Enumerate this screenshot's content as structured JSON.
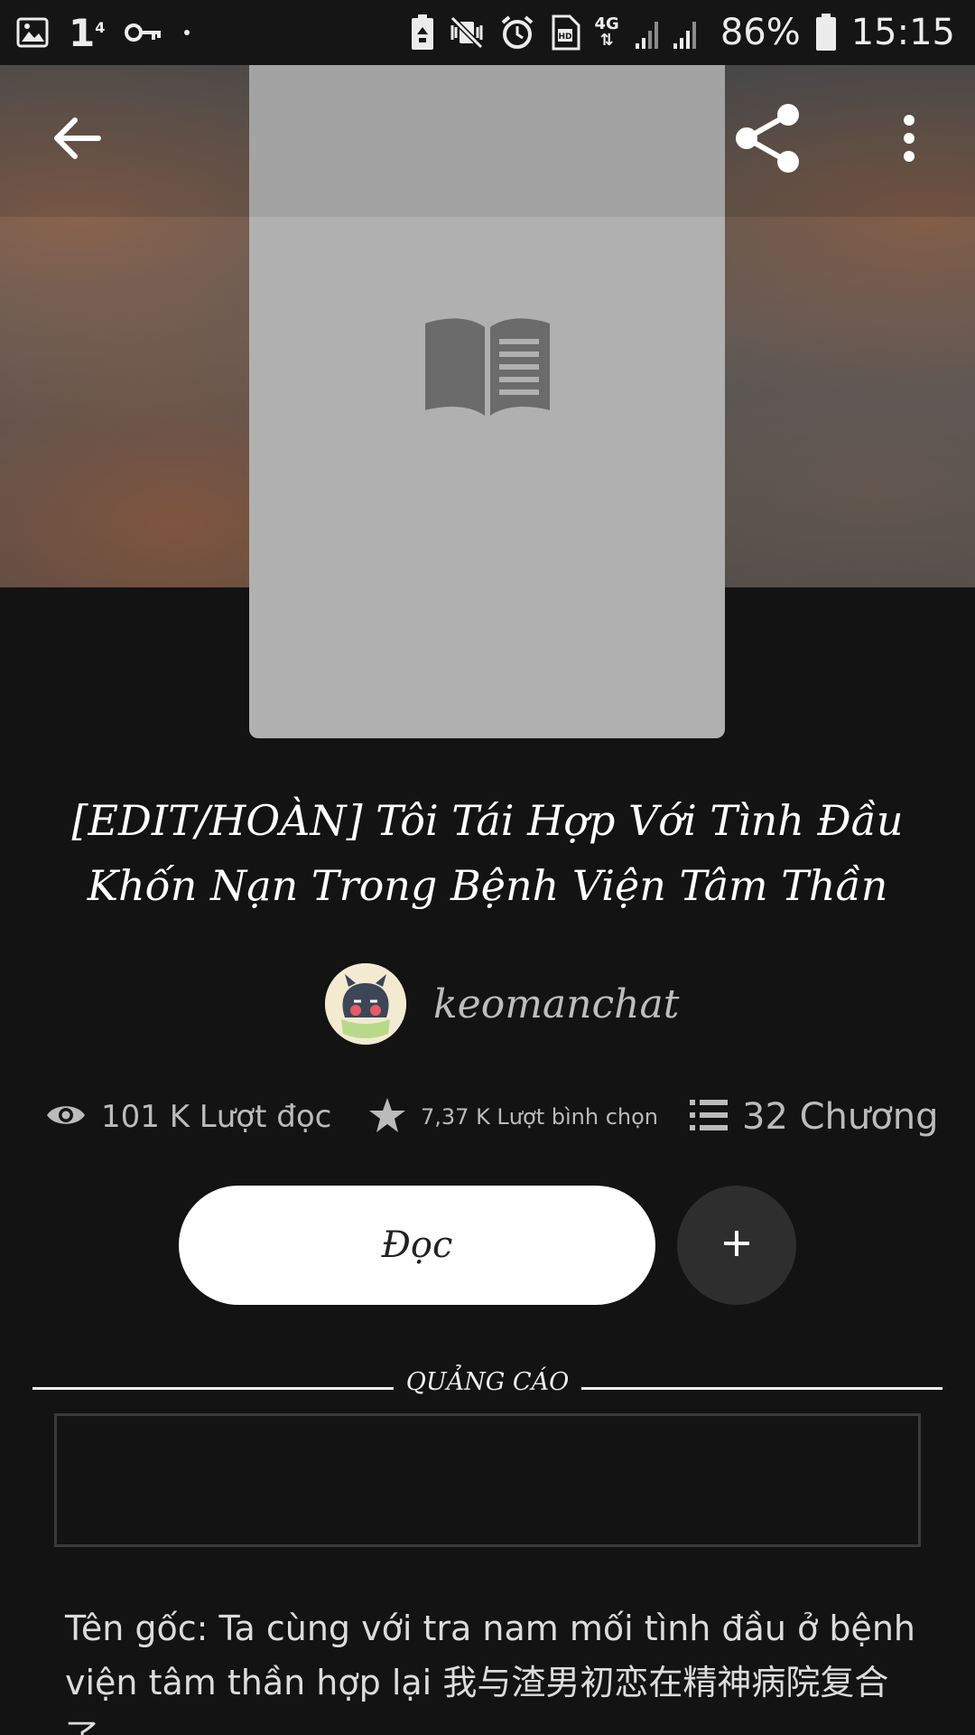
{
  "status_bar": {
    "notif_count": "1",
    "notif_sup": "4",
    "net_type": "4G",
    "battery": "86%",
    "time": "15:15",
    "icons": [
      "image-icon",
      "key-icon",
      "dot-icon",
      "battery-saver-icon",
      "mute-vibrate-icon",
      "alarm-icon",
      "sim-hd-icon",
      "signal-icon",
      "battery-icon"
    ]
  },
  "toolbar": {
    "back_icon": "arrow-left-icon",
    "share_icon": "share-icon",
    "more_icon": "more-vert-icon"
  },
  "story": {
    "title": "[EDIT/HOÀN] Tôi Tái Hợp Với Tình Đầu Khốn Nạn Trong Bệnh Viện Tâm Thần",
    "author": "keomanchat",
    "cover_placeholder_icon": "open-book-icon"
  },
  "stats": {
    "reads": "101 K Lượt đọc",
    "votes": "7,37 K Lượt bình chọn",
    "chapters": "32 Chương"
  },
  "actions": {
    "read_label": "Đọc",
    "add_label": "+"
  },
  "ad": {
    "label": "QUẢNG CÁO"
  },
  "description": {
    "text": "Tên gốc: Ta cùng với tra nam mối tình đầu ở bệnh viện tâm thần hợp lại 我与渣男初恋在精神病院复合了"
  },
  "colors": {
    "background": "#131313",
    "cover_placeholder": "#b0b0b0",
    "primary_button": "#ffffff",
    "secondary_button": "#2e2e2e",
    "stats_text": "#bbbbbb"
  }
}
